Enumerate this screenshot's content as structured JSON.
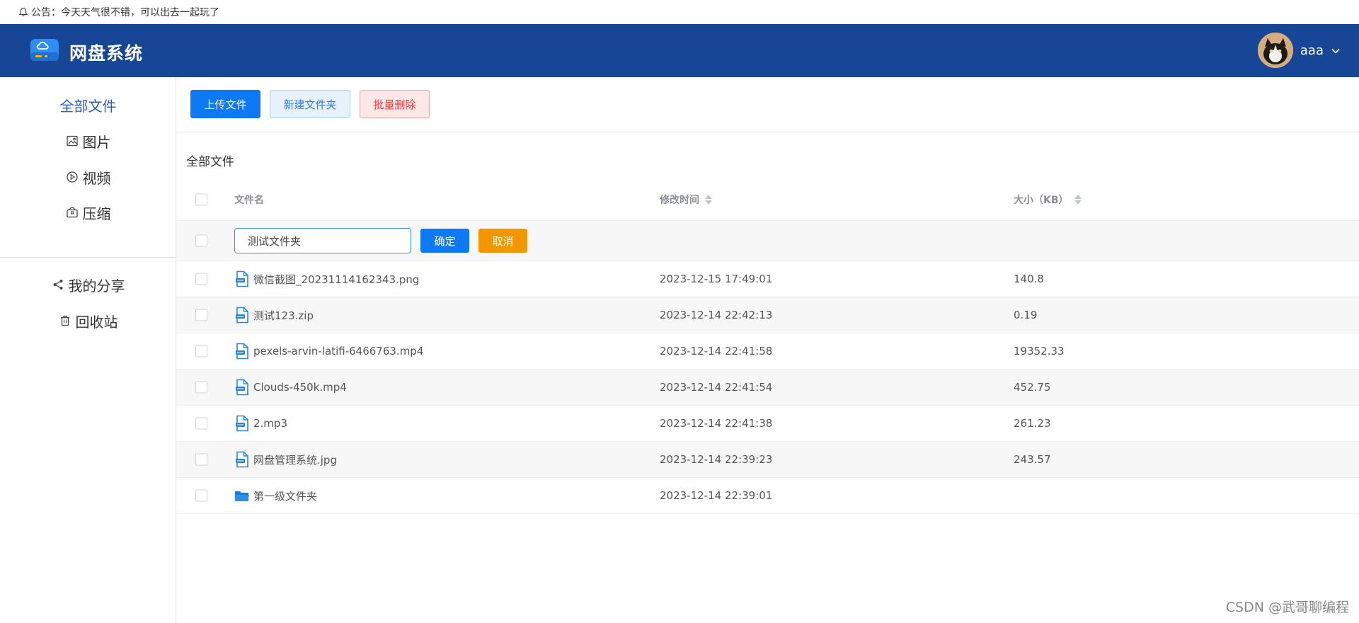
{
  "notice": {
    "label": "公告：",
    "text": "今天天气很不错，可以出去一起玩了"
  },
  "header": {
    "title": "网盘系统",
    "username": "aaa",
    "brand_color": "#174696"
  },
  "sidebar": {
    "items": [
      {
        "label": "全部文件",
        "icon": "none"
      },
      {
        "label": "图片",
        "icon": "image-icon"
      },
      {
        "label": "视频",
        "icon": "play-icon"
      },
      {
        "label": "压缩",
        "icon": "package-icon"
      },
      {
        "label": "我的分享",
        "icon": "share-icon"
      },
      {
        "label": "回收站",
        "icon": "trash-icon"
      }
    ]
  },
  "toolbar": {
    "upload_label": "上传文件",
    "new_folder_label": "新建文件夹",
    "batch_delete_label": "批量删除"
  },
  "content": {
    "title": "全部文件"
  },
  "table": {
    "columns": {
      "name": "文件名",
      "time": "修改时间",
      "size": "大小（KB）"
    },
    "edit_row": {
      "input_value": "测试文件夹",
      "confirm_label": "确定",
      "cancel_label": "取消"
    },
    "rows": [
      {
        "name": "微信截图_20231114162343.png",
        "time": "2023-12-15 17:49:01",
        "size": "140.8",
        "type": "file"
      },
      {
        "name": "测试123.zip",
        "time": "2023-12-14 22:42:13",
        "size": "0.19",
        "type": "file"
      },
      {
        "name": "pexels-arvin-latifi-6466763.mp4",
        "time": "2023-12-14 22:41:58",
        "size": "19352.33",
        "type": "file"
      },
      {
        "name": "Clouds-450k.mp4",
        "time": "2023-12-14 22:41:54",
        "size": "452.75",
        "type": "file"
      },
      {
        "name": "2.mp3",
        "time": "2023-12-14 22:41:38",
        "size": "261.23",
        "type": "file"
      },
      {
        "name": "网盘管理系统.jpg",
        "time": "2023-12-14 22:39:23",
        "size": "243.57",
        "type": "file"
      },
      {
        "name": "第一级文件夹",
        "time": "2023-12-14 22:39:01",
        "size": "",
        "type": "folder"
      }
    ]
  },
  "watermark": "CSDN @武哥聊编程"
}
